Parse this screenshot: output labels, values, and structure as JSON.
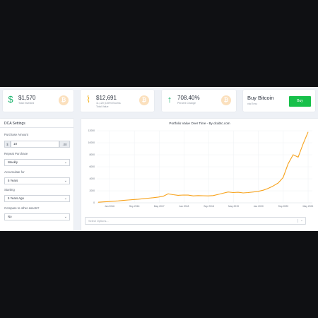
{
  "stats": [
    {
      "icon": "dollar-icon",
      "symbol": "$",
      "value": "$1,570",
      "label": "Total Invested"
    },
    {
      "icon": "pulse-icon",
      "symbol": "⌇",
      "value": "$12,691",
      "label1": "11,120 (100% Excess",
      "label2": "Total Value"
    },
    {
      "icon": "arrow-up-icon",
      "symbol": "↑",
      "value": "708.40%",
      "label": "Percent Change"
    }
  ],
  "buy": {
    "title": "Buy Bitcoin",
    "subtitle": "via Emu",
    "button": "Buy"
  },
  "settings": {
    "title": "DCA Settings",
    "amount_label": "Purchase Amount",
    "amount_prefix": "$",
    "amount_value": "10",
    "amount_suffix": ".00",
    "freq_label": "Repeat Purchase",
    "freq_value": "Weekly",
    "accum_label": "Accumulate for",
    "accum_value": "5 Years",
    "start_label": "Starting",
    "start_value": "5 Years Ago",
    "compare_label": "Compare to other assets?",
    "compare_value": "No"
  },
  "chart": {
    "title": "Portfolio Value Over Time - By dcabtc.com",
    "select_placeholder": "Select Options..."
  },
  "chart_data": {
    "type": "line",
    "title": "Portfolio Value Over Time - By dcabtc.com",
    "yticks": [
      "12000",
      "10000",
      "8000",
      "6000",
      "4000",
      "2000",
      "0"
    ],
    "xticks": [
      "Jan 2016",
      "Sep 2016",
      "May 2017",
      "Jan 2018",
      "Sep 2018",
      "May 2019",
      "Jan 2020",
      "Sep 2020",
      "May 2021"
    ],
    "ylim": [
      0,
      12000
    ],
    "color": "#f7a21b",
    "series": [
      {
        "values": [
          100,
          150,
          200,
          260,
          320,
          400,
          470,
          540,
          600,
          680,
          760,
          850,
          950,
          1100,
          1500,
          1350,
          1250,
          1300,
          1280,
          1150,
          1200,
          1180,
          1150,
          1200,
          1400,
          1600,
          1800,
          1700,
          1750,
          1650,
          1700,
          1800,
          1900,
          2100,
          2400,
          2800,
          3300,
          4200,
          6500,
          8000,
          7600,
          9800,
          11800
        ]
      }
    ]
  }
}
